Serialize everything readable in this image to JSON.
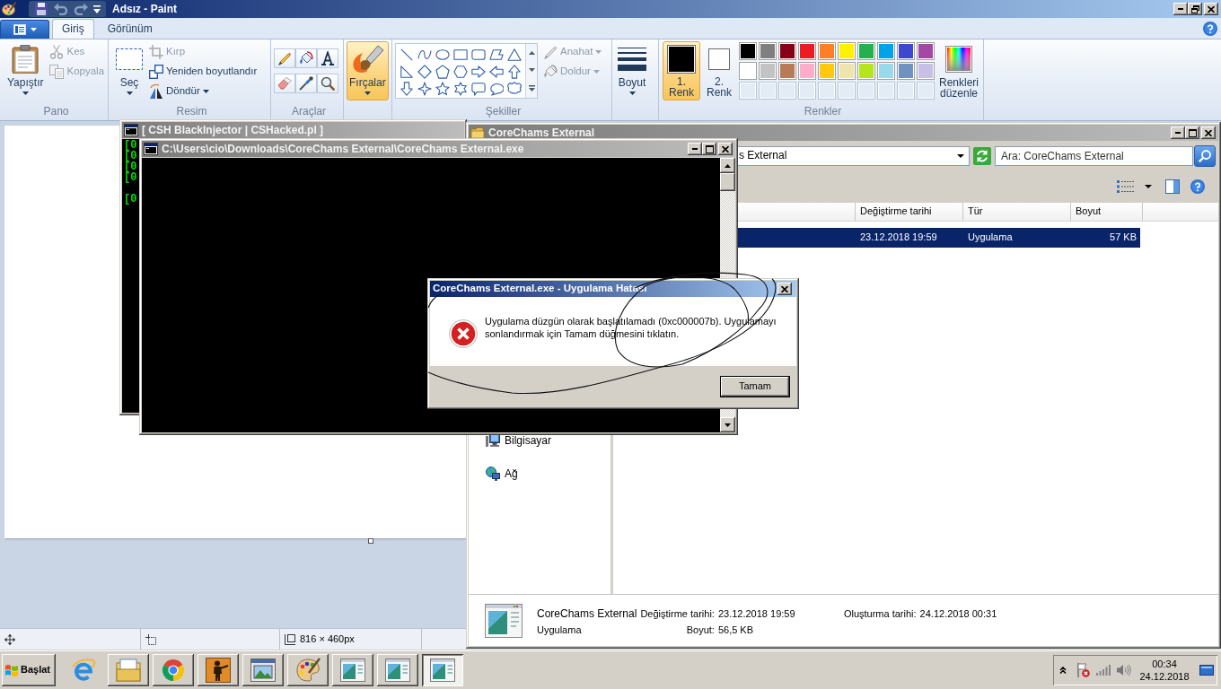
{
  "paint": {
    "title": "Adsız - Paint",
    "tabs": [
      {
        "label": "Giriş",
        "selected": true
      },
      {
        "label": "Görünüm",
        "selected": false
      }
    ],
    "ribbon": {
      "clipboard": {
        "label": "Pano",
        "paste": "Yapıştır",
        "actions": [
          {
            "kind": "cut",
            "label": "Kes",
            "disabled": true
          },
          {
            "kind": "copy",
            "label": "Kopyala",
            "disabled": true
          }
        ]
      },
      "image": {
        "label": "Resim",
        "select": "Seç",
        "actions": [
          {
            "kind": "crop",
            "label": "Kırp",
            "disabled": true
          },
          {
            "kind": "resize",
            "label": "Yeniden boyutlandır",
            "disabled": false
          },
          {
            "kind": "rotate",
            "label": "Döndür",
            "disabled": false
          }
        ]
      },
      "tools": {
        "label": "Araçlar"
      },
      "brushes": {
        "label": "Fırçalar",
        "selected": true
      },
      "shapes": {
        "label": "Şekiller",
        "options": [
          {
            "kind": "outline",
            "label": "Anahat",
            "disabled": true
          },
          {
            "kind": "fill",
            "label": "Doldur",
            "disabled": true
          }
        ]
      },
      "size": {
        "label": "Boyut"
      },
      "colors": {
        "label": "Renkler",
        "slots": [
          {
            "label": "1. Renk",
            "color": "#000000",
            "selected": true
          },
          {
            "label": "2. Renk",
            "color": "#ffffff",
            "selected": false
          }
        ],
        "palette": [
          {
            "kind": "swatch",
            "color": "#000000"
          },
          {
            "kind": "swatch",
            "color": "#7f7f7f"
          },
          {
            "kind": "swatch",
            "color": "#880015"
          },
          {
            "kind": "swatch",
            "color": "#ed1c24"
          },
          {
            "kind": "swatch",
            "color": "#ff7f27"
          },
          {
            "kind": "swatch",
            "color": "#fff200"
          },
          {
            "kind": "swatch",
            "color": "#22b14c"
          },
          {
            "kind": "swatch",
            "color": "#00a2e8"
          },
          {
            "kind": "swatch",
            "color": "#3f48cc"
          },
          {
            "kind": "swatch",
            "color": "#a349a4"
          },
          {
            "kind": "swatch",
            "color": "#ffffff"
          },
          {
            "kind": "swatch",
            "color": "#c3c3c3"
          },
          {
            "kind": "swatch",
            "color": "#b97a57"
          },
          {
            "kind": "swatch",
            "color": "#ffaec9"
          },
          {
            "kind": "swatch",
            "color": "#ffc90e"
          },
          {
            "kind": "swatch",
            "color": "#efe4b0"
          },
          {
            "kind": "swatch",
            "color": "#b5e61d"
          },
          {
            "kind": "swatch",
            "color": "#99d9ea"
          },
          {
            "kind": "swatch",
            "color": "#7092be"
          },
          {
            "kind": "swatch",
            "color": "#c8bfe7"
          },
          {
            "kind": "empty"
          },
          {
            "kind": "empty"
          },
          {
            "kind": "empty"
          },
          {
            "kind": "empty"
          },
          {
            "kind": "empty"
          },
          {
            "kind": "empty"
          },
          {
            "kind": "empty"
          },
          {
            "kind": "empty"
          },
          {
            "kind": "empty"
          },
          {
            "kind": "empty"
          }
        ],
        "edit": "Renkleri düzenle"
      }
    },
    "status_bar": {
      "canvas_size": "816 × 460px"
    }
  },
  "console_back": {
    "title": "[ CSH BlackInjector | CSHacked.pl ]",
    "blocks": [
      [
        "[0",
        "[0",
        "[0",
        "[0"
      ],
      [
        "[0"
      ]
    ]
  },
  "explorer": {
    "title": "CoreChams External",
    "address": "s External",
    "search": {
      "placeholder": "Ara: CoreChams External"
    },
    "columns": [
      "Değiştirme tarihi",
      "Tür",
      "Boyut"
    ],
    "rows": [
      {
        "cells": [
          "23.12.2018 19:59",
          "Uygulama",
          "57 KB"
        ],
        "selected": true
      }
    ],
    "nav": [
      {
        "kind": "computer",
        "label": "Bilgisayar"
      },
      {
        "kind": "network",
        "label": "Ağ"
      }
    ],
    "details": {
      "name": "CoreChams External",
      "type": "Uygulama",
      "fields": [
        {
          "label": "Değiştirme tarihi:",
          "value": "23.12.2018 19:59"
        },
        {
          "label": "Boyut:",
          "value": "56,5 KB"
        },
        {
          "label": "Oluşturma tarihi:",
          "value": "24.12.2018 00:31"
        }
      ]
    }
  },
  "console_front": {
    "title": "C:\\Users\\cio\\Downloads\\CoreChams External\\CoreChams External.exe"
  },
  "dialog": {
    "title": "CoreChams External.exe - Uygulama Hatası",
    "message": "Uygulama düzgün olarak başlatılamadı (0xc000007b). Uygulamayı sonlandırmak için Tamam düğmesini tıklatın.",
    "buttons": [
      "Tamam"
    ]
  },
  "taskbar": {
    "start": "Başlat",
    "buttons": [
      {
        "kind": "internet-explorer",
        "running": false,
        "selected": false
      },
      {
        "kind": "file-explorer",
        "running": true,
        "selected": false
      },
      {
        "kind": "chrome",
        "running": true,
        "selected": false
      },
      {
        "kind": "game",
        "running": true,
        "selected": false
      },
      {
        "kind": "picture-viewer",
        "running": true,
        "selected": false
      },
      {
        "kind": "paint",
        "running": true,
        "selected": false
      },
      {
        "kind": "app-window",
        "running": true,
        "selected": false
      },
      {
        "kind": "app-window",
        "running": true,
        "selected": false
      },
      {
        "kind": "app-window",
        "running": true,
        "selected": true
      }
    ],
    "clock": {
      "time": "00:34",
      "date": "24.12.2018"
    }
  }
}
